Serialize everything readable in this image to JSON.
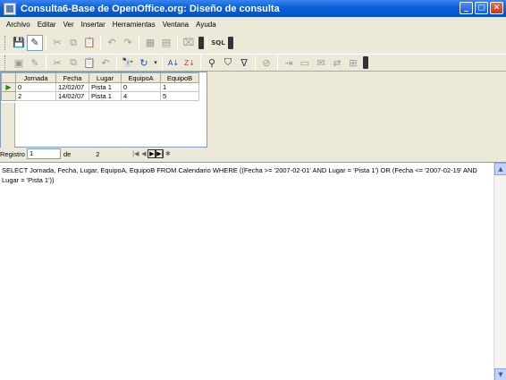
{
  "window": {
    "title": "Consulta6-Base de OpenOffice.org: Diseño de consulta",
    "controls": {
      "minimize": "_",
      "maximize": "▢",
      "close": "✕"
    }
  },
  "menu": [
    "Archivo",
    "Editar",
    "Ver",
    "Insertar",
    "Herramientas",
    "Ventana",
    "Ayuda"
  ],
  "toolbar1": {
    "icons": [
      "save-icon",
      "edit-icon",
      "cut-icon",
      "copy-icon",
      "paste-icon",
      "undo-icon",
      "redo-icon",
      "add-tables-icon",
      "functions-icon",
      "clear-icon",
      "sql-icon"
    ],
    "sql_label": "SQL"
  },
  "toolbar2": {
    "icons": [
      "save-record-icon",
      "edit-data-icon",
      "cut-icon",
      "copy-icon",
      "paste-icon",
      "undo-icon",
      "find-record-icon",
      "refresh-icon",
      "sort-ascending-icon",
      "sort-descending-icon",
      "autofilter-icon",
      "standard-filter-icon",
      "apply-filter-icon",
      "remove-filter-icon",
      "data-to-text-icon",
      "data-to-fields-icon",
      "mail-merge-icon",
      "data-source-icon",
      "explorer-icon"
    ]
  },
  "grid": {
    "columns": [
      "Jornada",
      "Fecha",
      "Lugar",
      "EquipoA",
      "EquipoB"
    ],
    "rows": [
      [
        "0",
        "12/02/07",
        "Pista 1",
        "0",
        "1"
      ],
      [
        "2",
        "14/02/07",
        "Pista 1",
        "4",
        "5"
      ]
    ]
  },
  "navigation": {
    "record_label": "Registro",
    "record_value": "1",
    "of_label": "de",
    "total": "2"
  },
  "sql": {
    "text": "SELECT Jornada, Fecha, Lugar, EquipoA, EquipoB FROM Calendario WHERE ((Fecha >= '2007-02-01' AND Lugar = 'Pista 1') OR (Fecha <= '2007-02-19' AND Lugar = 'Pista 1'))"
  },
  "colors": {
    "titlebar": "#0a5fd8",
    "chrome": "#ece9d8",
    "current_row_marker": "#1a8a1a"
  }
}
